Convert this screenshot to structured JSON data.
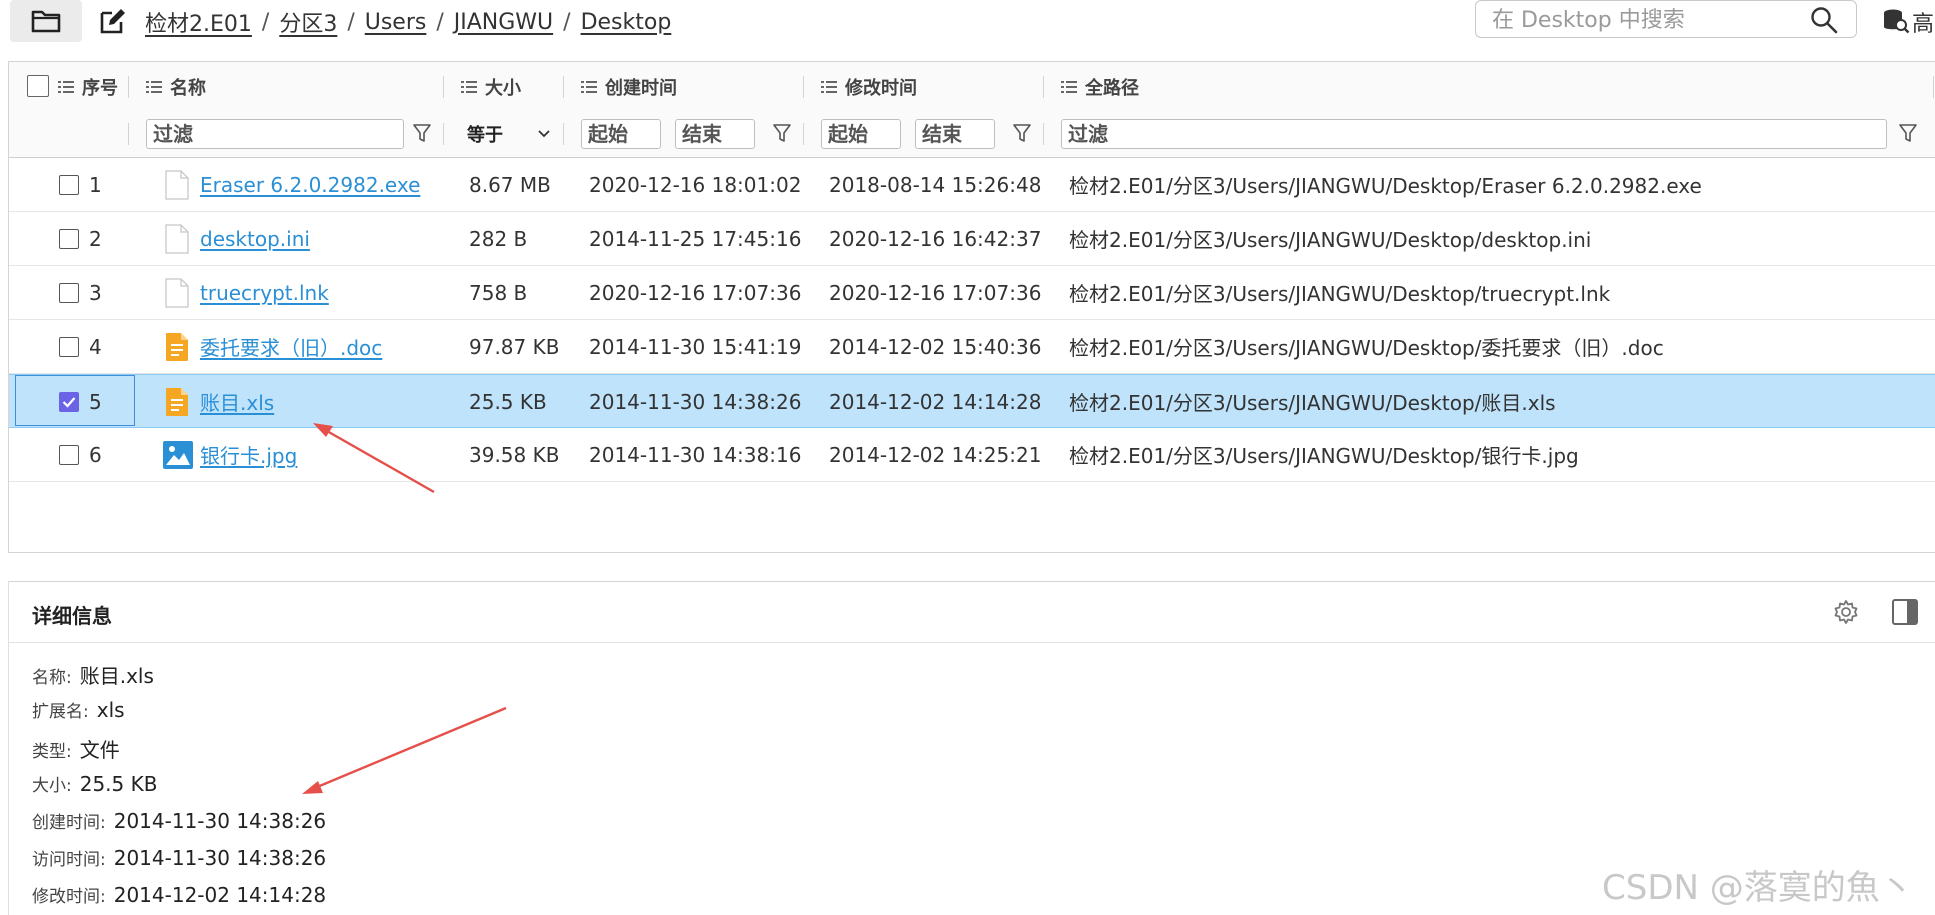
{
  "breadcrumb": [
    "检材2.E01",
    "分区3",
    "Users",
    "JIANGWU",
    "Desktop"
  ],
  "breadcrumb_sep": "/",
  "search": {
    "placeholder": "在 Desktop 中搜索"
  },
  "advanced_label": "高",
  "table": {
    "columns": {
      "index": "序号",
      "name": "名称",
      "size": "大小",
      "created": "创建时间",
      "modified": "修改时间",
      "path": "全路径"
    },
    "filters": {
      "name_placeholder": "过滤",
      "size_op": "等于",
      "created_start": "起始",
      "created_end": "结束",
      "modified_start": "起始",
      "modified_end": "结束",
      "path_placeholder": "过滤"
    },
    "rows": [
      {
        "index": "1",
        "name": "Eraser 6.2.0.2982.exe",
        "icon": "blank-file-icon",
        "size": "8.67 MB",
        "created": "2020-12-16 18:01:02",
        "modified": "2018-08-14 15:26:48",
        "path": "检材2.E01/分区3/Users/JIANGWU/Desktop/Eraser 6.2.0.2982.exe",
        "checked": false
      },
      {
        "index": "2",
        "name": "desktop.ini",
        "icon": "blank-file-icon",
        "size": "282 B",
        "created": "2014-11-25 17:45:16",
        "modified": "2020-12-16 16:42:37",
        "path": "检材2.E01/分区3/Users/JIANGWU/Desktop/desktop.ini",
        "checked": false
      },
      {
        "index": "3",
        "name": "truecrypt.lnk",
        "icon": "blank-file-icon",
        "size": "758 B",
        "created": "2020-12-16 17:07:36",
        "modified": "2020-12-16 17:07:36",
        "path": "检材2.E01/分区3/Users/JIANGWU/Desktop/truecrypt.lnk",
        "checked": false
      },
      {
        "index": "4",
        "name": "委托要求（旧）.doc",
        "icon": "document-file-icon",
        "size": "97.87 KB",
        "created": "2014-11-30 15:41:19",
        "modified": "2014-12-02 15:40:36",
        "path": "检材2.E01/分区3/Users/JIANGWU/Desktop/委托要求（旧）.doc",
        "checked": false
      },
      {
        "index": "5",
        "name": "账目.xls",
        "icon": "document-file-icon",
        "size": "25.5 KB",
        "created": "2014-11-30 14:38:26",
        "modified": "2014-12-02 14:14:28",
        "path": "检材2.E01/分区3/Users/JIANGWU/Desktop/账目.xls",
        "checked": true
      },
      {
        "index": "6",
        "name": "银行卡.jpg",
        "icon": "image-file-icon",
        "size": "39.58 KB",
        "created": "2014-11-30 14:38:16",
        "modified": "2014-12-02 14:25:21",
        "path": "检材2.E01/分区3/Users/JIANGWU/Desktop/银行卡.jpg",
        "checked": false
      }
    ]
  },
  "details": {
    "title": "详细信息",
    "fields": [
      {
        "label": "名称:",
        "value": "账目.xls"
      },
      {
        "label": "扩展名:",
        "value": "xls"
      },
      {
        "label": "类型:",
        "value": "文件"
      },
      {
        "label": "大小:",
        "value": "25.5 KB"
      },
      {
        "label": "创建时间:",
        "value": "2014-11-30 14:38:26"
      },
      {
        "label": "访问时间:",
        "value": "2014-11-30 14:38:26"
      },
      {
        "label": "修改时间:",
        "value": "2014-12-02 14:14:28"
      }
    ]
  },
  "watermark": "CSDN @落寞的魚丶",
  "colors": {
    "selected_row": "#bfe3fb",
    "link": "#2b8fd6",
    "checkbox_checked": "#6a63e6",
    "doc_icon": "#f5a623",
    "image_icon": "#2b8fd6",
    "annotation_arrow": "#e5504b"
  }
}
